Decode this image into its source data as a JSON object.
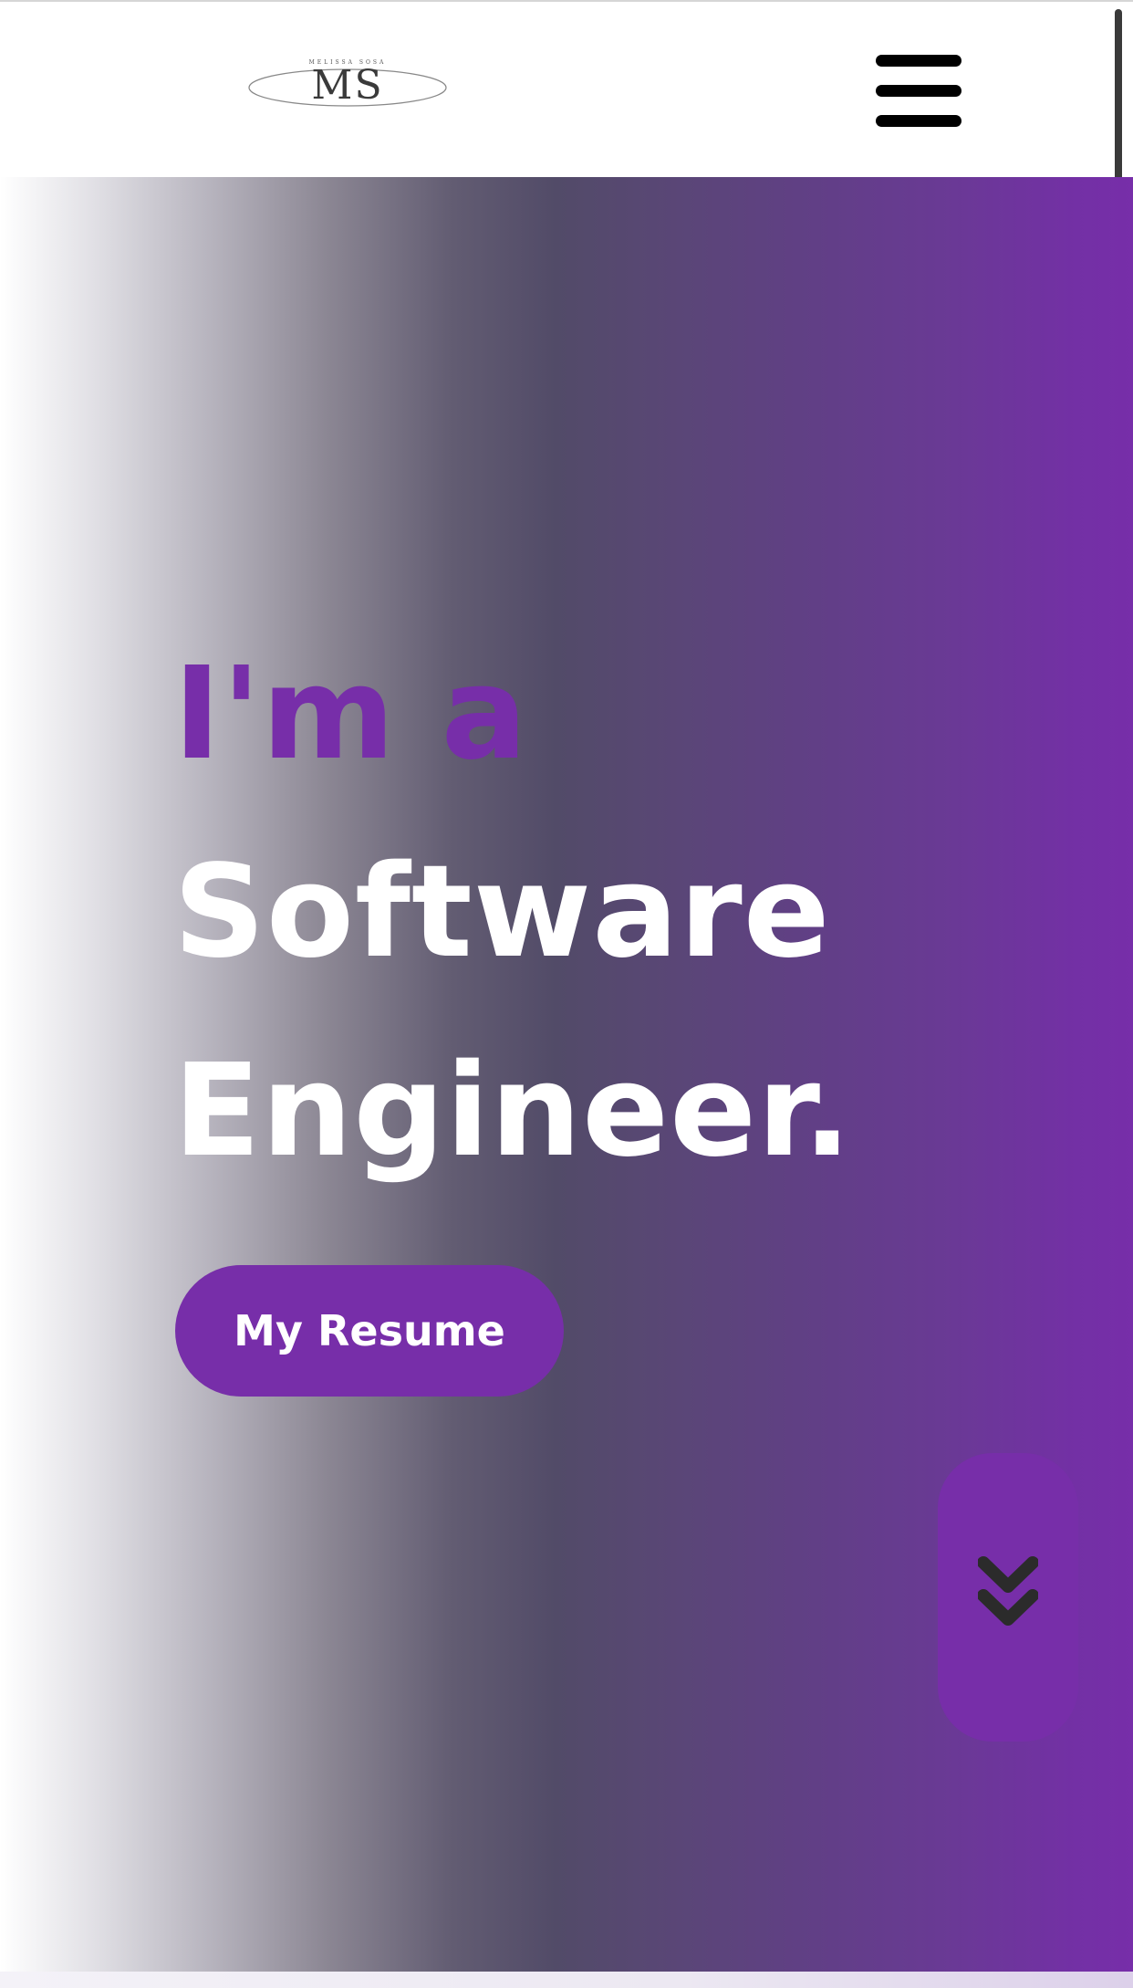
{
  "header": {
    "logo_text": "MS",
    "logo_tagline": "MELISSA SOSA",
    "menu_icon": "hamburger-menu-icon"
  },
  "hero": {
    "line1": "I'm a",
    "line2": "Software",
    "line3": "Engineer.",
    "resume_button_label": "My Resume",
    "scroll_icon": "double-chevron-down-icon"
  },
  "colors": {
    "accent": "#772ea9",
    "button_bg": "#772ea9",
    "hero_text": "#ffffff",
    "menu_icon": "#000000",
    "scroll_icon": "#2b2b2b"
  }
}
